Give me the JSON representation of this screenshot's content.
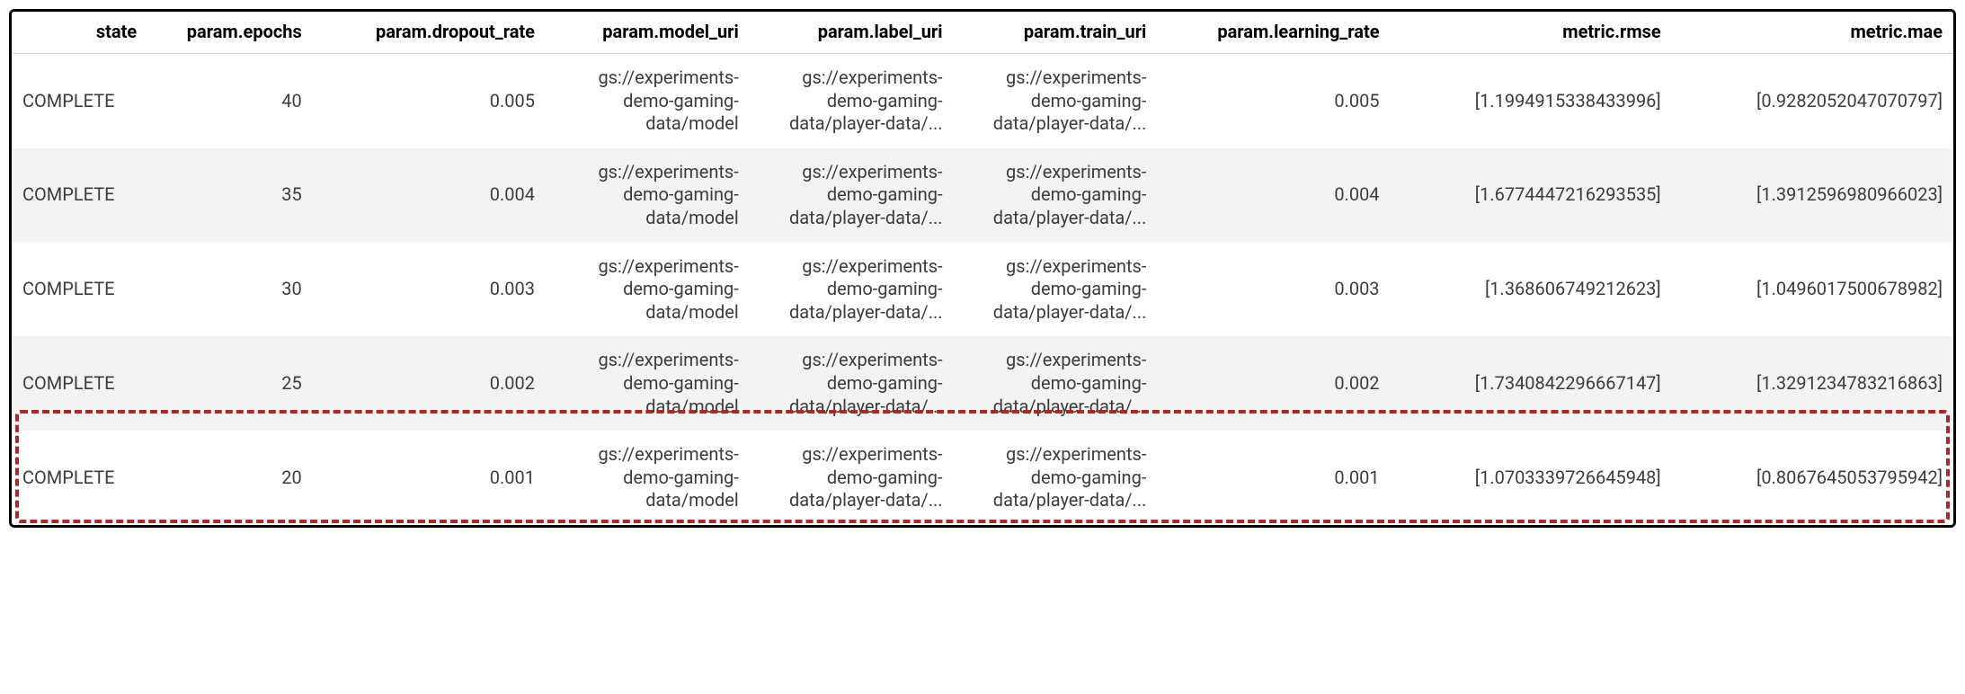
{
  "columns": {
    "state": "state",
    "epochs": "param.epochs",
    "dropout": "param.dropout_rate",
    "model_uri": "param.model_uri",
    "label_uri": "param.label_uri",
    "train_uri": "param.train_uri",
    "lr": "param.learning_rate",
    "rmse": "metric.rmse",
    "mae": "metric.mae"
  },
  "rows": [
    {
      "state": "COMPLETE",
      "epochs": "40",
      "dropout": "0.005",
      "model_uri": "gs://experiments-demo-gaming-data/model",
      "label_uri": "gs://experiments-demo-gaming-data/player-data/...",
      "train_uri": "gs://experiments-demo-gaming-data/player-data/...",
      "lr": "0.005",
      "rmse": "[1.1994915338433996]",
      "mae": "[0.9282052047070797]"
    },
    {
      "state": "COMPLETE",
      "epochs": "35",
      "dropout": "0.004",
      "model_uri": "gs://experiments-demo-gaming-data/model",
      "label_uri": "gs://experiments-demo-gaming-data/player-data/...",
      "train_uri": "gs://experiments-demo-gaming-data/player-data/...",
      "lr": "0.004",
      "rmse": "[1.6774447216293535]",
      "mae": "[1.3912596980966023]"
    },
    {
      "state": "COMPLETE",
      "epochs": "30",
      "dropout": "0.003",
      "model_uri": "gs://experiments-demo-gaming-data/model",
      "label_uri": "gs://experiments-demo-gaming-data/player-data/...",
      "train_uri": "gs://experiments-demo-gaming-data/player-data/...",
      "lr": "0.003",
      "rmse": "[1.368606749212623]",
      "mae": "[1.0496017500678982]"
    },
    {
      "state": "COMPLETE",
      "epochs": "25",
      "dropout": "0.002",
      "model_uri": "gs://experiments-demo-gaming-data/model",
      "label_uri": "gs://experiments-demo-gaming-data/player-data/...",
      "train_uri": "gs://experiments-demo-gaming-data/player-data/...",
      "lr": "0.002",
      "rmse": "[1.7340842296667147]",
      "mae": "[1.3291234783216863]"
    },
    {
      "state": "COMPLETE",
      "epochs": "20",
      "dropout": "0.001",
      "model_uri": "gs://experiments-demo-gaming-data/model",
      "label_uri": "gs://experiments-demo-gaming-data/player-data/...",
      "train_uri": "gs://experiments-demo-gaming-data/player-data/...",
      "lr": "0.001",
      "rmse": "[1.0703339726645948]",
      "mae": "[0.8067645053795942]"
    }
  ]
}
